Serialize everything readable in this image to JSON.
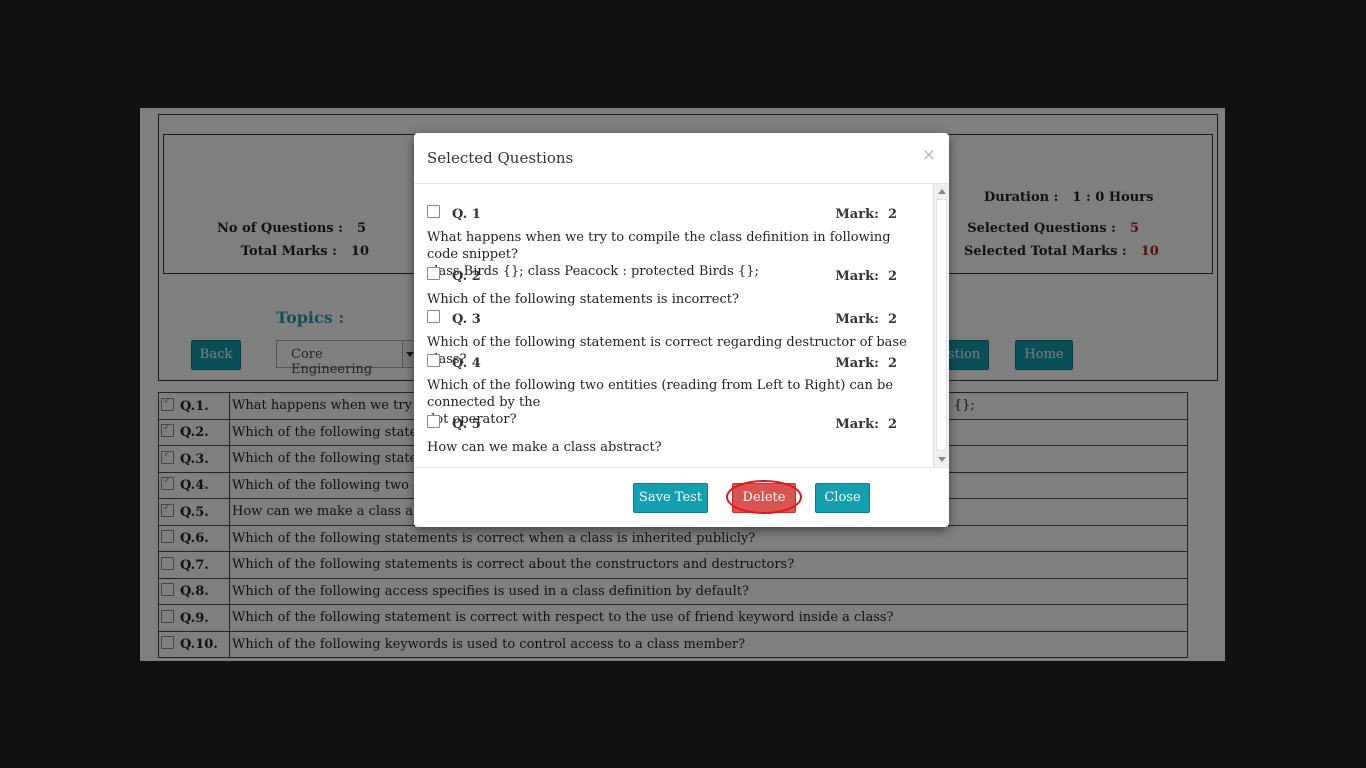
{
  "info": {
    "no_of_questions_label": "No of Questions :",
    "no_of_questions_value": "5",
    "total_marks_label": "Total Marks :",
    "total_marks_value": "10",
    "duration_label": "Duration :",
    "duration_value": "1 : 0 Hours",
    "selected_questions_label": "Selected Questions :",
    "selected_questions_value": "5",
    "selected_total_marks_label": "Selected Total Marks :",
    "selected_total_marks_value": "10"
  },
  "topics_label": "Topics :",
  "toolbar": {
    "back_label": "Back",
    "topic_select_value": "Core Engineering",
    "partial_button_label": "stion",
    "home_label": "Home"
  },
  "table": {
    "rows": [
      {
        "no": "Q.1.",
        "text": "What happens when we try to co",
        "tail": "s {};",
        "checked": true
      },
      {
        "no": "Q.2.",
        "text": "Which of the following statement",
        "tail": "",
        "checked": true
      },
      {
        "no": "Q.3.",
        "text": "Which of the following statement",
        "tail": "",
        "checked": true
      },
      {
        "no": "Q.4.",
        "text": "Which of the following two entiti",
        "tail": "",
        "checked": true
      },
      {
        "no": "Q.5.",
        "text": "How can we make a class abstrac",
        "tail": "",
        "checked": true
      },
      {
        "no": "Q.6.",
        "text": "Which of the following statements is correct when a class is inherited publicly?",
        "tail": "",
        "checked": false
      },
      {
        "no": "Q.7.",
        "text": "Which of the following statements is correct about the constructors and destructors?",
        "tail": "",
        "checked": false
      },
      {
        "no": "Q.8.",
        "text": "Which of the following access specifies is used in a class definition by default?",
        "tail": "",
        "checked": false
      },
      {
        "no": "Q.9.",
        "text": "Which of the following statement is correct with respect to the use of friend keyword inside a class?",
        "tail": "",
        "checked": false
      },
      {
        "no": "Q.10.",
        "text": "Which of the following keywords is used to control access to a class member?",
        "tail": "",
        "checked": false
      }
    ]
  },
  "modal": {
    "title": "Selected Questions",
    "close_glyph": "×",
    "mark_label": "Mark:",
    "questions": [
      {
        "no": "Q. 1",
        "mark": "2",
        "text_line1": "What happens when we try to compile the class definition in following code snippet?",
        "text_line2": "class Birds {}; class Peacock : protected Birds {};"
      },
      {
        "no": "Q. 2",
        "mark": "2",
        "text_line1": "Which of the following statements is incorrect?",
        "text_line2": ""
      },
      {
        "no": "Q. 3",
        "mark": "2",
        "text_line1": "Which of the following statement is correct regarding destructor of base class?",
        "text_line2": ""
      },
      {
        "no": "Q. 4",
        "mark": "2",
        "text_line1": "Which of the following two entities (reading from Left to Right) can be connected by the",
        "text_line2": "dot operator?"
      },
      {
        "no": "Q. 5",
        "mark": "2",
        "text_line1": "How can we make a class abstract?",
        "text_line2": ""
      }
    ],
    "save_label": "Save Test",
    "delete_label": "Delete",
    "close_label": "Close"
  },
  "colors": {
    "accent": "#139faf",
    "danger": "#d9534f",
    "highlight_ring": "#e0141e",
    "value_red": "#b8141a",
    "topics_color": "#2d9bb2"
  }
}
